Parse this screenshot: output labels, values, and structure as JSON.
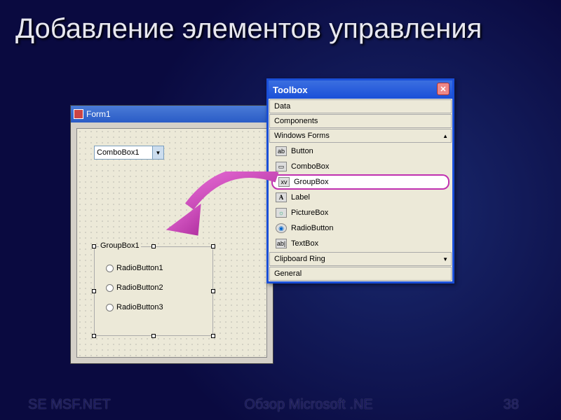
{
  "slide": {
    "title": "Добавление элементов управления"
  },
  "footer": {
    "left": "SE MSF.NET",
    "center": "Обзор Microsoft .NE",
    "right": "38"
  },
  "form": {
    "title": "Form1",
    "combobox": "ComboBox1",
    "groupbox": {
      "legend": "GroupBox1",
      "radios": [
        "RadioButton1",
        "RadioButton2",
        "RadioButton3"
      ]
    }
  },
  "toolbox": {
    "title": "Toolbox",
    "sections_top": [
      "Data",
      "Components",
      "Windows Forms"
    ],
    "items": [
      {
        "icon": "ab",
        "label": "Button"
      },
      {
        "icon": "▭",
        "label": "ComboBox"
      },
      {
        "icon": "xv",
        "label": "GroupBox",
        "selected": true
      },
      {
        "icon": "A",
        "label": "Label"
      },
      {
        "icon": "☼",
        "label": "PictureBox"
      },
      {
        "icon": "◉",
        "label": "RadioButton"
      },
      {
        "icon": "ab|",
        "label": "TextBox"
      }
    ],
    "sections_bottom": [
      "Clipboard Ring",
      "General"
    ]
  }
}
